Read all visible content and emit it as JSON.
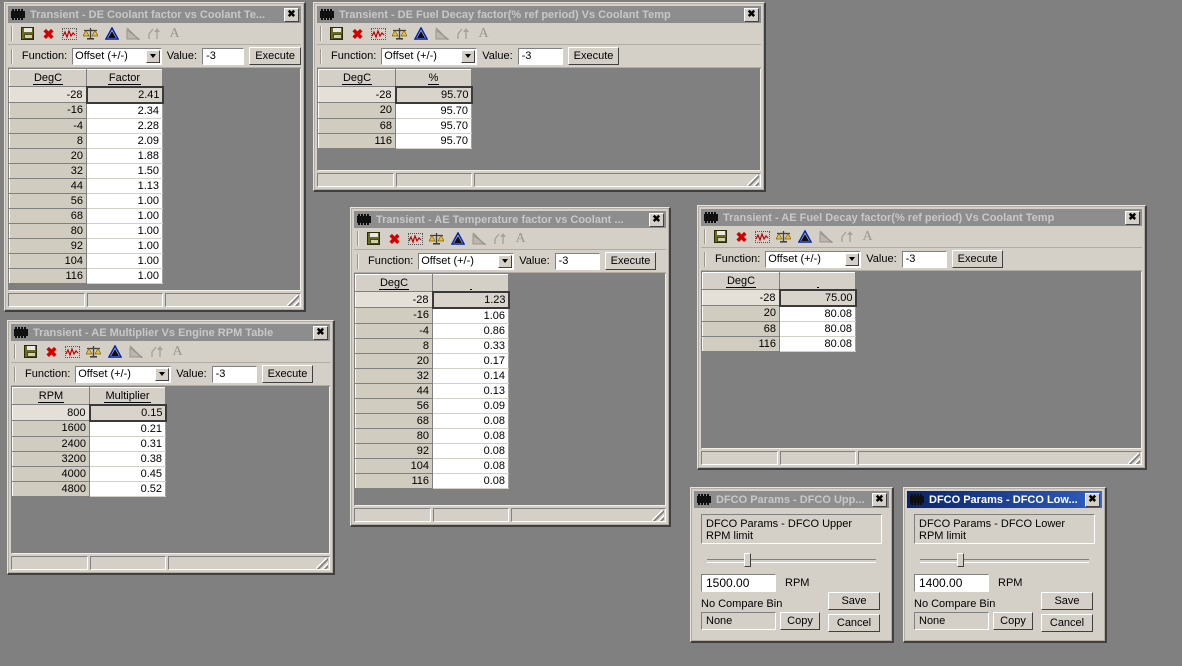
{
  "desktop": {
    "background": "#808080"
  },
  "toolbar_common": {
    "icons": [
      {
        "name": "save-icon",
        "label": "Save"
      },
      {
        "name": "delete-icon",
        "label": "Delete"
      },
      {
        "name": "graph-icon",
        "label": "Graph"
      },
      {
        "name": "compare-icon",
        "label": "Compare"
      },
      {
        "name": "histogram-icon",
        "label": "Histogram"
      },
      {
        "name": "histogram-disabled-icon",
        "label": "Histogram (disabled)"
      },
      {
        "name": "interpolate-icon",
        "label": "Interpolate (disabled)"
      },
      {
        "name": "text-icon",
        "label": "Text (disabled)"
      }
    ],
    "function_label": "Function:",
    "function_value": "Offset (+/-)",
    "value_label": "Value:",
    "value_value": "-3",
    "execute_label": "Execute",
    "close_glyph": "✖"
  },
  "windows": [
    {
      "id": "de-coolant-factor",
      "title": "Transient - DE Coolant factor vs Coolant Te...",
      "active": false,
      "columns": [
        "DegC",
        "Factor"
      ],
      "rows": [
        {
          "k": "-28",
          "v": "2.41"
        },
        {
          "k": "-16",
          "v": "2.34"
        },
        {
          "k": "-4",
          "v": "2.28"
        },
        {
          "k": "8",
          "v": "2.09"
        },
        {
          "k": "20",
          "v": "1.88"
        },
        {
          "k": "32",
          "v": "1.50"
        },
        {
          "k": "44",
          "v": "1.13"
        },
        {
          "k": "56",
          "v": "1.00"
        },
        {
          "k": "68",
          "v": "1.00"
        },
        {
          "k": "80",
          "v": "1.00"
        },
        {
          "k": "92",
          "v": "1.00"
        },
        {
          "k": "104",
          "v": "1.00"
        },
        {
          "k": "116",
          "v": "1.00"
        }
      ]
    },
    {
      "id": "de-fuel-decay",
      "title": "Transient - DE Fuel Decay factor(% ref period)  Vs Coolant Temp",
      "active": false,
      "columns": [
        "DegC",
        "%"
      ],
      "rows": [
        {
          "k": "-28",
          "v": "95.70"
        },
        {
          "k": "20",
          "v": "95.70"
        },
        {
          "k": "68",
          "v": "95.70"
        },
        {
          "k": "116",
          "v": "95.70"
        }
      ]
    },
    {
      "id": "ae-temperature-factor",
      "title": "Transient - AE Temperature factor vs Coolant ...",
      "active": false,
      "columns": [
        "DegC",
        ""
      ],
      "rows": [
        {
          "k": "-28",
          "v": "1.23"
        },
        {
          "k": "-16",
          "v": "1.06"
        },
        {
          "k": "-4",
          "v": "0.86"
        },
        {
          "k": "8",
          "v": "0.33"
        },
        {
          "k": "20",
          "v": "0.17"
        },
        {
          "k": "32",
          "v": "0.14"
        },
        {
          "k": "44",
          "v": "0.13"
        },
        {
          "k": "56",
          "v": "0.09"
        },
        {
          "k": "68",
          "v": "0.08"
        },
        {
          "k": "80",
          "v": "0.08"
        },
        {
          "k": "92",
          "v": "0.08"
        },
        {
          "k": "104",
          "v": "0.08"
        },
        {
          "k": "116",
          "v": "0.08"
        }
      ]
    },
    {
      "id": "ae-fuel-decay",
      "title": "Transient - AE Fuel Decay factor(% ref period)  Vs Coolant Temp",
      "active": false,
      "columns": [
        "DegC",
        ""
      ],
      "rows": [
        {
          "k": "-28",
          "v": "75.00"
        },
        {
          "k": "20",
          "v": "80.08"
        },
        {
          "k": "68",
          "v": "80.08"
        },
        {
          "k": "116",
          "v": "80.08"
        }
      ]
    },
    {
      "id": "ae-multiplier",
      "title": "Transient - AE Multiplier Vs Engine RPM Table",
      "active": false,
      "columns": [
        "RPM",
        "Multiplier"
      ],
      "rows": [
        {
          "k": "800",
          "v": "0.15"
        },
        {
          "k": "1600",
          "v": "0.21"
        },
        {
          "k": "2400",
          "v": "0.31"
        },
        {
          "k": "3200",
          "v": "0.38"
        },
        {
          "k": "4000",
          "v": "0.45"
        },
        {
          "k": "4800",
          "v": "0.52"
        }
      ]
    }
  ],
  "dialogs": [
    {
      "id": "dfco-upper",
      "title": "DFCO Params - DFCO Upp...",
      "active": false,
      "description": "DFCO Params - DFCO Upper RPM limit",
      "value": "1500.00",
      "unit": "RPM",
      "compare_label": "No Compare Bin",
      "bin_value": "None",
      "copy_label": "Copy",
      "save_label": "Save",
      "cancel_label": "Cancel",
      "slider_pct": 23
    },
    {
      "id": "dfco-lower",
      "title": "DFCO Params - DFCO Low...",
      "active": true,
      "description": "DFCO Params - DFCO Lower RPM limit",
      "value": "1400.00",
      "unit": "RPM",
      "compare_label": "No Compare Bin",
      "bin_value": "None",
      "copy_label": "Copy",
      "save_label": "Save",
      "cancel_label": "Cancel",
      "slider_pct": 23
    }
  ]
}
